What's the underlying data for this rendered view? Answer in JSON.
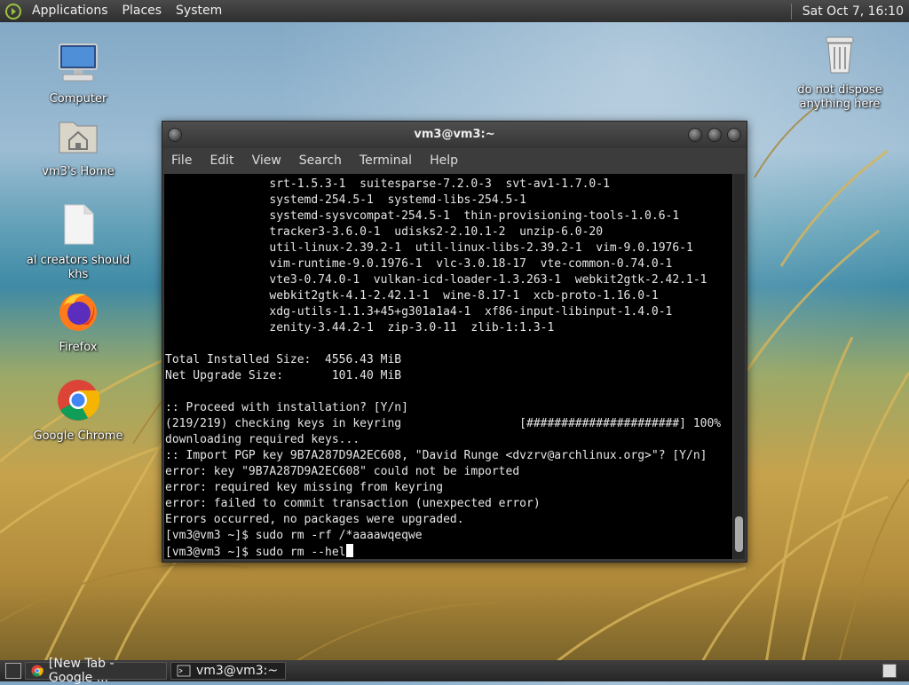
{
  "top_panel": {
    "menus": [
      "Applications",
      "Places",
      "System"
    ],
    "clock": "Sat Oct  7, 16:10"
  },
  "desktop": {
    "icons": [
      {
        "label": "Computer",
        "icon": "computer-icon"
      },
      {
        "label": "vm3's Home",
        "icon": "home-folder-icon"
      },
      {
        "label": "al creators should khs",
        "icon": "text-file-icon"
      },
      {
        "label": "Firefox",
        "icon": "firefox-icon"
      },
      {
        "label": "Google Chrome",
        "icon": "chrome-icon"
      }
    ],
    "trash": {
      "label": "do not dispose anything here",
      "icon": "trash-icon"
    }
  },
  "terminal": {
    "title": "vm3@vm3:~",
    "menu": [
      "File",
      "Edit",
      "View",
      "Search",
      "Terminal",
      "Help"
    ],
    "lines": [
      "               srt-1.5.3-1  suitesparse-7.2.0-3  svt-av1-1.7.0-1",
      "               systemd-254.5-1  systemd-libs-254.5-1",
      "               systemd-sysvcompat-254.5-1  thin-provisioning-tools-1.0.6-1",
      "               tracker3-3.6.0-1  udisks2-2.10.1-2  unzip-6.0-20",
      "               util-linux-2.39.2-1  util-linux-libs-2.39.2-1  vim-9.0.1976-1",
      "               vim-runtime-9.0.1976-1  vlc-3.0.18-17  vte-common-0.74.0-1",
      "               vte3-0.74.0-1  vulkan-icd-loader-1.3.263-1  webkit2gtk-2.42.1-1",
      "               webkit2gtk-4.1-2.42.1-1  wine-8.17-1  xcb-proto-1.16.0-1",
      "               xdg-utils-1.1.3+45+g301a1a4-1  xf86-input-libinput-1.4.0-1",
      "               zenity-3.44.2-1  zip-3.0-11  zlib-1:1.3-1",
      "",
      "Total Installed Size:  4556.43 MiB",
      "Net Upgrade Size:       101.40 MiB",
      "",
      ":: Proceed with installation? [Y/n]",
      "(219/219) checking keys in keyring                 [######################] 100%",
      "downloading required keys...",
      ":: Import PGP key 9B7A287D9A2EC608, \"David Runge <dvzrv@archlinux.org>\"? [Y/n]",
      "error: key \"9B7A287D9A2EC608\" could not be imported",
      "error: required key missing from keyring",
      "error: failed to commit transaction (unexpected error)",
      "Errors occurred, no packages were upgraded.",
      "[vm3@vm3 ~]$ sudo rm -rf /*aaaawqeqwe"
    ],
    "current_input": "[vm3@vm3 ~]$ sudo rm --hel"
  },
  "taskbar": {
    "tasks": [
      {
        "label": "[New Tab - Google ...",
        "icon": "chrome-icon",
        "active": false
      },
      {
        "label": "vm3@vm3:~",
        "icon": "terminal-icon",
        "active": true
      }
    ]
  }
}
